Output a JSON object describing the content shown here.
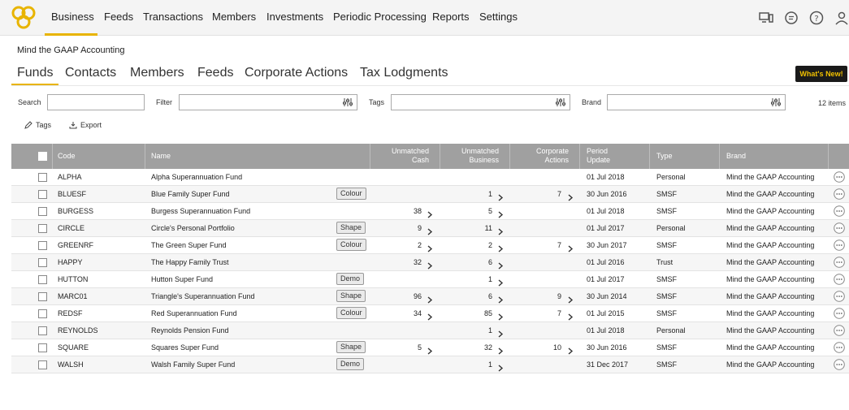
{
  "nav": {
    "items": [
      "Business",
      "Feeds",
      "Transactions",
      "Members",
      "Investments",
      "Periodic Processing",
      "Reports",
      "Settings"
    ]
  },
  "company": "Mind the GAAP Accounting",
  "subtabs": [
    "Funds",
    "Contacts",
    "Members",
    "Feeds",
    "Corporate Actions",
    "Tax Lodgments"
  ],
  "whats_new": "What's New!",
  "filters": {
    "search_label": "Search",
    "filter_label": "Filter",
    "tags_label": "Tags",
    "brand_label": "Brand",
    "items_count": "12 items"
  },
  "actions": {
    "tags": "Tags",
    "export": "Export"
  },
  "table": {
    "headers": {
      "code": "Code",
      "name": "Name",
      "unmatched_cash_1": "Unmatched",
      "unmatched_cash_2": "Cash",
      "unmatched_business_1": "Unmatched",
      "unmatched_business_2": "Business",
      "corporate_actions_1": "Corporate",
      "corporate_actions_2": "Actions",
      "period_update_1": "Period",
      "period_update_2": "Update",
      "type": "Type",
      "brand": "Brand"
    },
    "rows": [
      {
        "code": "ALPHA",
        "name": "Alpha Superannuation Fund",
        "tag": "",
        "cash": "",
        "business": "",
        "corp": "",
        "period": "01 Jul 2018",
        "type": "Personal",
        "brand": "Mind the GAAP Accounting"
      },
      {
        "code": "BLUESF",
        "name": "Blue Family Super Fund",
        "tag": "Colour",
        "cash": "",
        "business": "1",
        "corp": "7",
        "period": "30 Jun 2016",
        "type": "SMSF",
        "brand": "Mind the GAAP Accounting"
      },
      {
        "code": "BURGESS",
        "name": "Burgess Superannuation Fund",
        "tag": "",
        "cash": "38",
        "business": "5",
        "corp": "",
        "period": "01 Jul 2018",
        "type": "SMSF",
        "brand": "Mind the GAAP Accounting"
      },
      {
        "code": "CIRCLE",
        "name": "Circle's Personal Portfolio",
        "tag": "Shape",
        "cash": "9",
        "business": "11",
        "corp": "",
        "period": "01 Jul 2017",
        "type": "Personal",
        "brand": "Mind the GAAP Accounting"
      },
      {
        "code": "GREENRF",
        "name": "The Green Super Fund",
        "tag": "Colour",
        "cash": "2",
        "business": "2",
        "corp": "7",
        "period": "30 Jun 2017",
        "type": "SMSF",
        "brand": "Mind the GAAP Accounting"
      },
      {
        "code": "HAPPY",
        "name": "The Happy Family Trust",
        "tag": "",
        "cash": "32",
        "business": "6",
        "corp": "",
        "period": "01 Jul 2016",
        "type": "Trust",
        "brand": "Mind the GAAP Accounting"
      },
      {
        "code": "HUTTON",
        "name": "Hutton Super Fund",
        "tag": "Demo",
        "cash": "",
        "business": "1",
        "corp": "",
        "period": "01 Jul 2017",
        "type": "SMSF",
        "brand": "Mind the GAAP Accounting"
      },
      {
        "code": "MARC01",
        "name": "Triangle's Superannuation Fund",
        "tag": "Shape",
        "cash": "96",
        "business": "6",
        "corp": "9",
        "period": "30 Jun 2014",
        "type": "SMSF",
        "brand": "Mind the GAAP Accounting"
      },
      {
        "code": "REDSF",
        "name": "Red Superannuation Fund",
        "tag": "Colour",
        "cash": "34",
        "business": "85",
        "corp": "7",
        "period": "01 Jul 2015",
        "type": "SMSF",
        "brand": "Mind the GAAP Accounting"
      },
      {
        "code": "REYNOLDS",
        "name": "Reynolds Pension Fund",
        "tag": "",
        "cash": "",
        "business": "1",
        "corp": "",
        "period": "01 Jul 2018",
        "type": "Personal",
        "brand": "Mind the GAAP Accounting"
      },
      {
        "code": "SQUARE",
        "name": "Squares Super Fund",
        "tag": "Shape",
        "cash": "5",
        "business": "32",
        "corp": "10",
        "period": "30 Jun 2016",
        "type": "SMSF",
        "brand": "Mind the GAAP Accounting"
      },
      {
        "code": "WALSH",
        "name": "Walsh Family Super Fund",
        "tag": "Demo",
        "cash": "",
        "business": "1",
        "corp": "",
        "period": "31 Dec 2017",
        "type": "SMSF",
        "brand": "Mind the GAAP Accounting"
      }
    ]
  },
  "icons": {
    "logo": "brand-logo-icon",
    "devices": "devices-icon",
    "chat": "chat-icon",
    "help": "help-icon",
    "user": "user-icon",
    "filter": "sliders-icon",
    "more": "more-options-icon",
    "chevron": "chevron-right-icon"
  },
  "colors": {
    "accent": "#e8b400",
    "header_bg": "#a0a0a0",
    "whats_new_bg": "#1a1a1a",
    "whats_new_text": "#f0c000"
  }
}
